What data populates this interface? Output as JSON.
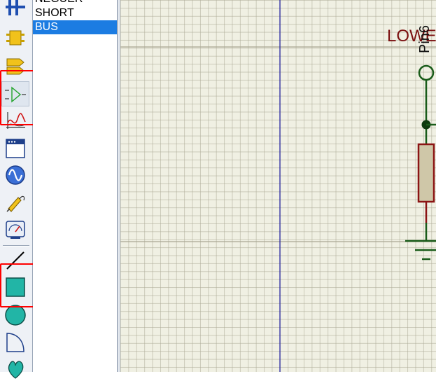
{
  "toolbar": {
    "tools": [
      {
        "id": "bus-connector",
        "icon": "bus-connector-icon"
      },
      {
        "id": "component",
        "icon": "chip-icon"
      },
      {
        "id": "terminal",
        "icon": "terminal-label-icon"
      },
      {
        "id": "device-pin",
        "icon": "device-pin-icon"
      },
      {
        "id": "graph",
        "icon": "graph-icon"
      },
      {
        "id": "tape-recorder",
        "icon": "window-icon"
      },
      {
        "id": "generator",
        "icon": "sine-generator-icon"
      },
      {
        "id": "voltage-probe",
        "icon": "probe-icon"
      },
      {
        "id": "virtual-instrument",
        "icon": "meter-icon"
      },
      {
        "id": "line",
        "icon": "line-icon"
      },
      {
        "id": "box",
        "icon": "box-icon"
      },
      {
        "id": "circle",
        "icon": "circle-icon"
      },
      {
        "id": "arc",
        "icon": "arc-icon"
      },
      {
        "id": "path",
        "icon": "path-shape-icon"
      }
    ],
    "highlight_color": "#ff0000"
  },
  "object_list": {
    "items": [
      "NEGUER",
      "SHORT",
      "BUS"
    ],
    "selected_index": 2
  },
  "canvas": {
    "net_label": "LOWE",
    "pin_label": "Pin6",
    "wire_color": "#1a5c1a",
    "component_color": "#8b1414"
  }
}
